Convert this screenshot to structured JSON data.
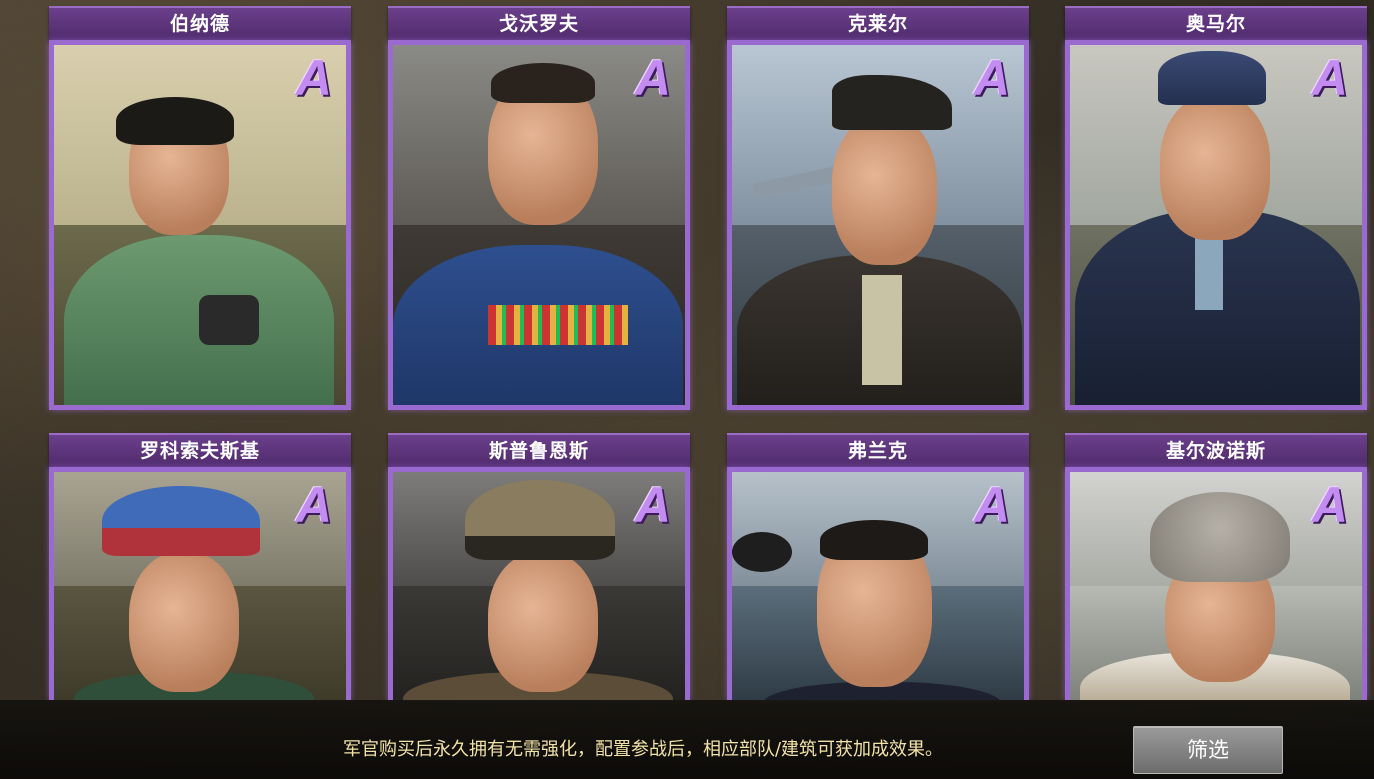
{
  "cards": [
    {
      "name": "伯纳德",
      "rank": "A"
    },
    {
      "name": "戈沃罗夫",
      "rank": "A"
    },
    {
      "name": "克莱尔",
      "rank": "A"
    },
    {
      "name": "奥马尔",
      "rank": "A"
    },
    {
      "name": "罗科索夫斯基",
      "rank": "A"
    },
    {
      "name": "斯普鲁恩斯",
      "rank": "A"
    },
    {
      "name": "弗兰克",
      "rank": "A"
    },
    {
      "name": "基尔波诺斯",
      "rank": "A"
    }
  ],
  "footer": {
    "notice": "军官购买后永久拥有无需强化，配置参战后，相应部队/建筑可获加成效果。",
    "filter_label": "筛选"
  },
  "colors": {
    "card_frame": "#9b6ad0",
    "title_bar": "#6b3f8c",
    "rank_letter": "#c28cf0",
    "notice_text": "#f1e2a8"
  }
}
